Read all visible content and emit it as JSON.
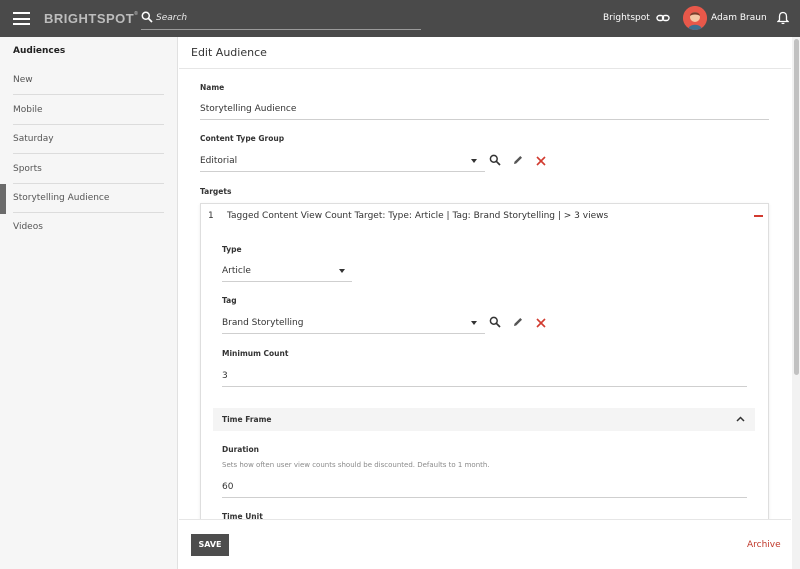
{
  "topbar": {
    "logo": "BRIGHTSPOT",
    "logo_tm": "®",
    "search_placeholder": "Search",
    "site_name": "Brightspot",
    "user_name": "Adam Braun",
    "icons": [
      "menu-icon",
      "search-icon",
      "link-icon",
      "avatar",
      "bell-icon"
    ]
  },
  "sidebar": {
    "title": "Audiences",
    "items": [
      {
        "label": "New"
      },
      {
        "label": "Mobile"
      },
      {
        "label": "Saturday"
      },
      {
        "label": "Sports"
      },
      {
        "label": "Storytelling Audience",
        "active": true
      },
      {
        "label": "Videos"
      }
    ]
  },
  "main": {
    "title": "Edit Audience",
    "name": {
      "label": "Name",
      "value": "Storytelling Audience"
    },
    "content_type_group": {
      "label": "Content Type Group",
      "value": "Editorial"
    },
    "targets": {
      "label": "Targets",
      "items": [
        {
          "index": "1",
          "summary": "Tagged Content View Count Target: Type: Article | Tag: Brand Storytelling | > 3 views",
          "type": {
            "label": "Type",
            "value": "Article"
          },
          "tag": {
            "label": "Tag",
            "value": "Brand Storytelling"
          },
          "minimum_count": {
            "label": "Minimum Count",
            "value": "3"
          },
          "time_frame": {
            "title": "Time Frame",
            "duration": {
              "label": "Duration",
              "hint": "Sets how often user view counts should be discounted. Defaults to 1 month.",
              "value": "60"
            },
            "time_unit": {
              "label": "Time Unit"
            }
          }
        }
      ]
    }
  },
  "footer": {
    "save_label": "SAVE",
    "archive_label": "Archive"
  },
  "colors": {
    "topbar": "#4a4a4a",
    "danger": "#d23a2f",
    "sidebar_bg": "#f6f6f6",
    "button": "#4d4d4d"
  }
}
